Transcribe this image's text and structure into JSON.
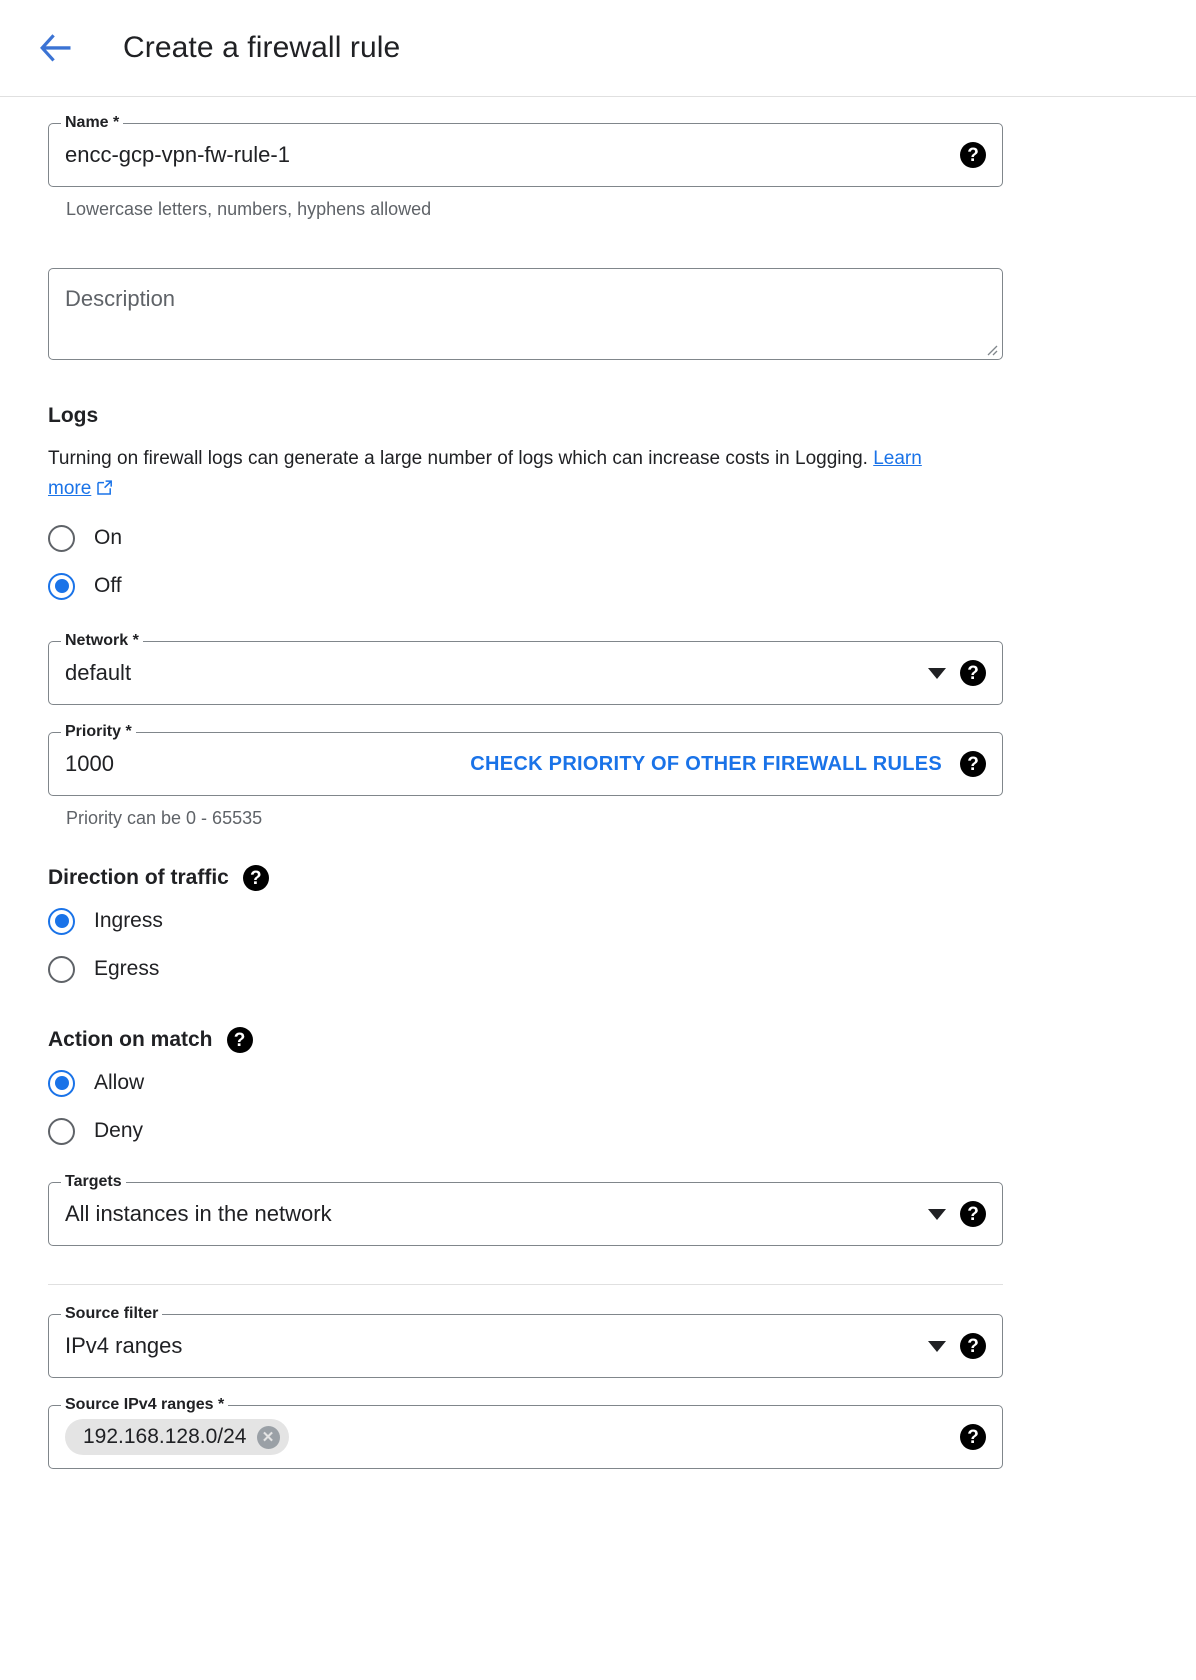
{
  "header": {
    "back_icon": "arrow-left-icon",
    "title": "Create a firewall rule"
  },
  "colors": {
    "accent_blue": "#1a73e8",
    "border_gray": "#80868b",
    "help_icon_bg": "#000000",
    "chip_bg": "#e4e4e4"
  },
  "form": {
    "name": {
      "label": "Name *",
      "value": "encc-gcp-vpn-fw-rule-1",
      "helper": "Lowercase letters, numbers, hyphens allowed",
      "help_icon": "help-icon"
    },
    "description": {
      "placeholder": "Description"
    },
    "logs": {
      "title": "Logs",
      "description_before": " Turning on firewall logs can generate a large number of logs which can increase costs in Logging.",
      "link_text": "Learn more",
      "link_icon": "external-link-icon",
      "options": [
        {
          "label": "On",
          "selected": false
        },
        {
          "label": "Off",
          "selected": true
        }
      ]
    },
    "network": {
      "label": "Network *",
      "value": "default",
      "caret": "chevron-down-icon",
      "help_icon": "help-icon"
    },
    "priority": {
      "label": "Priority *",
      "value": "1000",
      "action_label": "CHECK PRIORITY OF OTHER FIREWALL RULES",
      "helper": "Priority can be 0 - 65535",
      "help_icon": "help-icon"
    },
    "direction": {
      "title": "Direction of traffic",
      "help_icon": "help-icon",
      "options": [
        {
          "label": "Ingress",
          "selected": true
        },
        {
          "label": "Egress",
          "selected": false
        }
      ]
    },
    "action_on_match": {
      "title": "Action on match",
      "help_icon": "help-icon",
      "options": [
        {
          "label": "Allow",
          "selected": true
        },
        {
          "label": "Deny",
          "selected": false
        }
      ]
    },
    "targets": {
      "label": "Targets",
      "value": "All instances in the network",
      "caret": "chevron-down-icon",
      "help_icon": "help-icon"
    },
    "source_filter": {
      "label": "Source filter",
      "value": "IPv4 ranges",
      "caret": "chevron-down-icon",
      "help_icon": "help-icon"
    },
    "source_ranges": {
      "label": "Source IPv4 ranges *",
      "chips": [
        {
          "label": "192.168.128.0/24",
          "remove_icon": "close-icon"
        }
      ],
      "help_icon": "help-icon"
    }
  }
}
